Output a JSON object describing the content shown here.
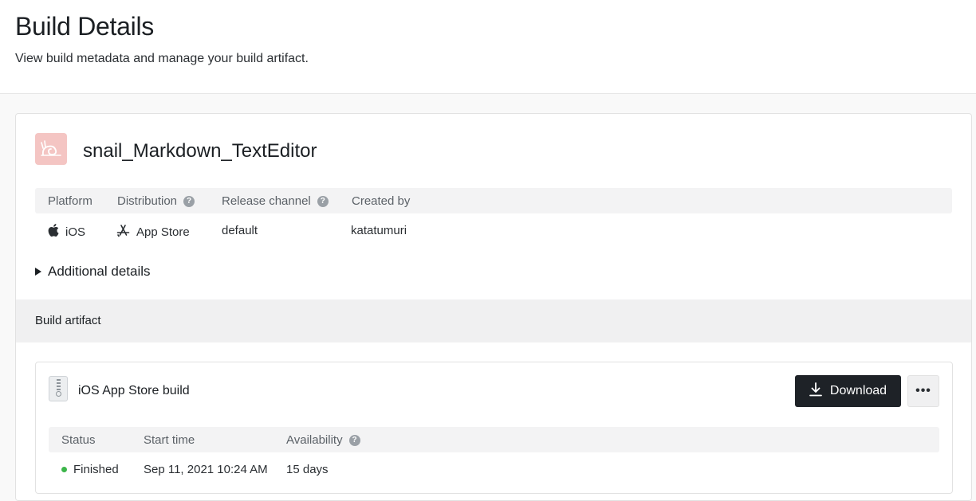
{
  "header": {
    "title": "Build Details",
    "subtitle": "View build metadata and manage your build artifact."
  },
  "app": {
    "name": "snail_Markdown_TextEditor",
    "icon": "snail-app-icon"
  },
  "metadata": {
    "columns": [
      "Platform",
      "Distribution",
      "Release channel",
      "Created by"
    ],
    "values": {
      "platform": "iOS",
      "distribution": "App Store",
      "release_channel": "default",
      "created_by": "katatumuri"
    }
  },
  "additional_details_label": "Additional details",
  "artifact_section": {
    "title": "Build artifact"
  },
  "artifact": {
    "name": "iOS App Store build",
    "download_label": "Download",
    "more_label": "•••",
    "columns": [
      "Status",
      "Start time",
      "Availability"
    ],
    "values": {
      "status": "Finished",
      "start_time": "Sep 11, 2021 10:24 AM",
      "availability": "15 days"
    },
    "status_color": "#3cb54a"
  },
  "help_glyph": "?"
}
